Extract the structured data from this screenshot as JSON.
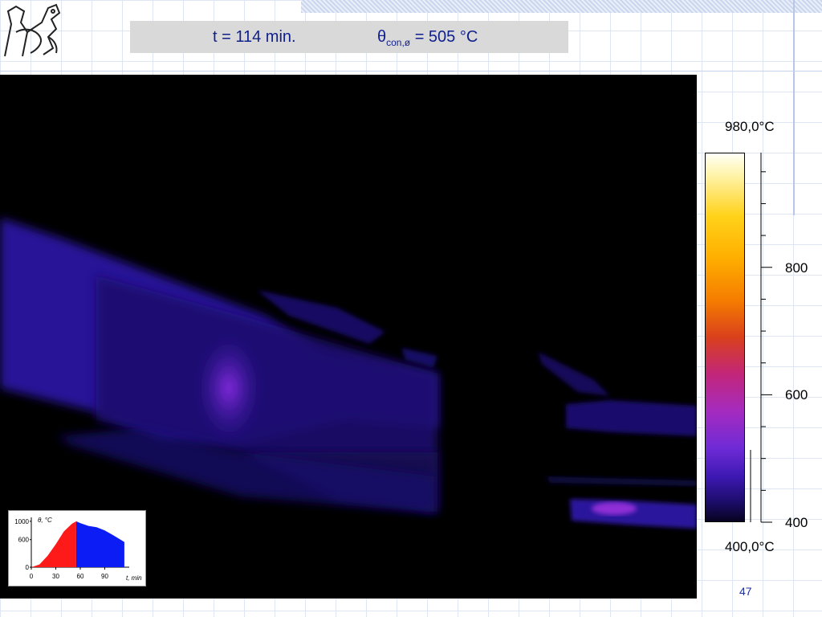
{
  "slide": {
    "time_label": "t = 114 min.",
    "temp_symbol": "θ",
    "temp_subscript": "con,ø",
    "temp_value": " = 505 °C",
    "page_number": "47"
  },
  "colorbar": {
    "max_label": "980,0°C",
    "min_label": "400,0°C",
    "ticks": [
      "800",
      "600",
      "400"
    ],
    "range": [
      400,
      980
    ]
  },
  "inset_chart": {
    "chart_data": {
      "type": "area",
      "ylabel": "θ, °C",
      "xlabel": "t, min",
      "y_ticks": [
        "1000",
        "600",
        "0"
      ],
      "x_ticks": [
        "0",
        "30",
        "60",
        "90"
      ],
      "series": [
        {
          "values_x": [
            0,
            10,
            20,
            30,
            40,
            50,
            55
          ],
          "values_y": [
            0,
            60,
            250,
            500,
            780,
            950,
            1000
          ],
          "color": "#ff1a1a"
        },
        {
          "values_x": [
            55,
            60,
            70,
            80,
            90,
            100,
            114
          ],
          "values_y": [
            1000,
            960,
            900,
            870,
            800,
            700,
            550
          ],
          "color": "#0b1cf5"
        }
      ],
      "xlim": [
        0,
        120
      ],
      "ylim": [
        0,
        1050
      ]
    }
  },
  "colors": {
    "title_text": "#0f1f8c",
    "title_bar": "#d9d9d9"
  }
}
